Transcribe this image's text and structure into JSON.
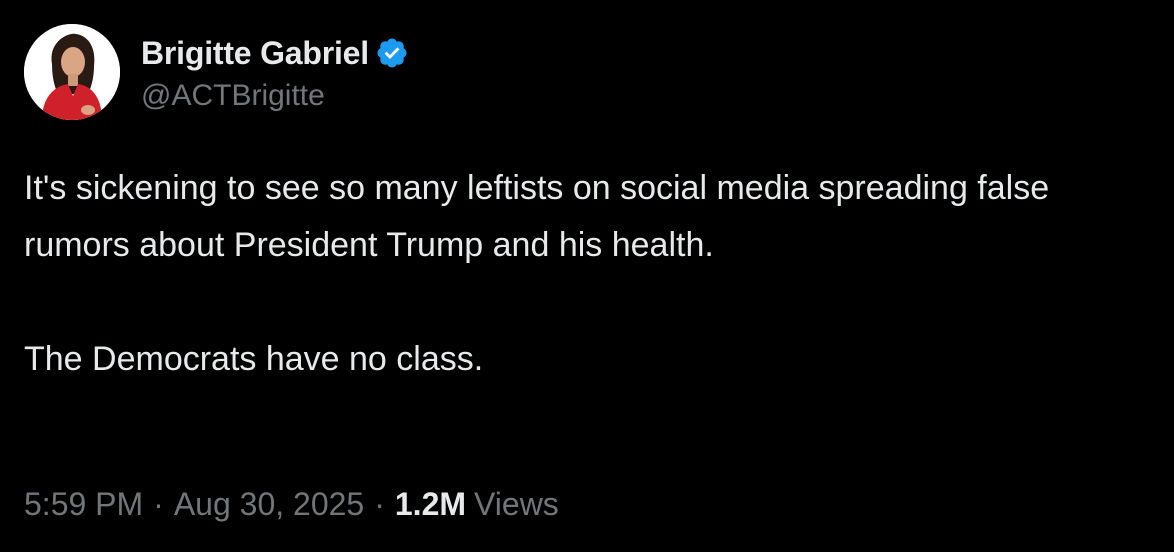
{
  "author": {
    "display_name": "Brigitte Gabriel",
    "handle": "@ACTBrigitte",
    "verified": true,
    "verified_color": "#1d9bf0"
  },
  "tweet": {
    "paragraphs": [
      "It's sickening to see so many leftists on social media spreading false rumors about President Trump and his health.",
      "The Democrats have no class."
    ],
    "time": "5:59 PM",
    "separator": "·",
    "date": "Aug 30, 2025",
    "views_count": "1.2M",
    "views_label": "Views"
  },
  "colors": {
    "background": "#000000",
    "primary_text": "#e7e9ea",
    "secondary_text": "#71767b",
    "avatar_outfit": "#d0202a"
  },
  "icons": {
    "verified": "verified-badge-icon",
    "avatar": "profile-photo"
  }
}
